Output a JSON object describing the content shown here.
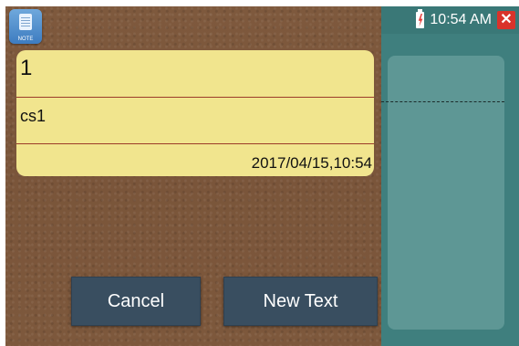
{
  "app": {
    "icon_label": "NOTE"
  },
  "status_bar": {
    "time": "10:54 AM",
    "close_symbol": "✕"
  },
  "note": {
    "title": "1",
    "body": "cs1",
    "timestamp": "2017/04/15,10:54"
  },
  "buttons": {
    "cancel": "Cancel",
    "new_text": "New Text"
  },
  "colors": {
    "note_bg": "#f1e58e",
    "button_bg": "#394e60",
    "teal_panel": "#3f7f7e",
    "close_red": "#d9332b"
  }
}
